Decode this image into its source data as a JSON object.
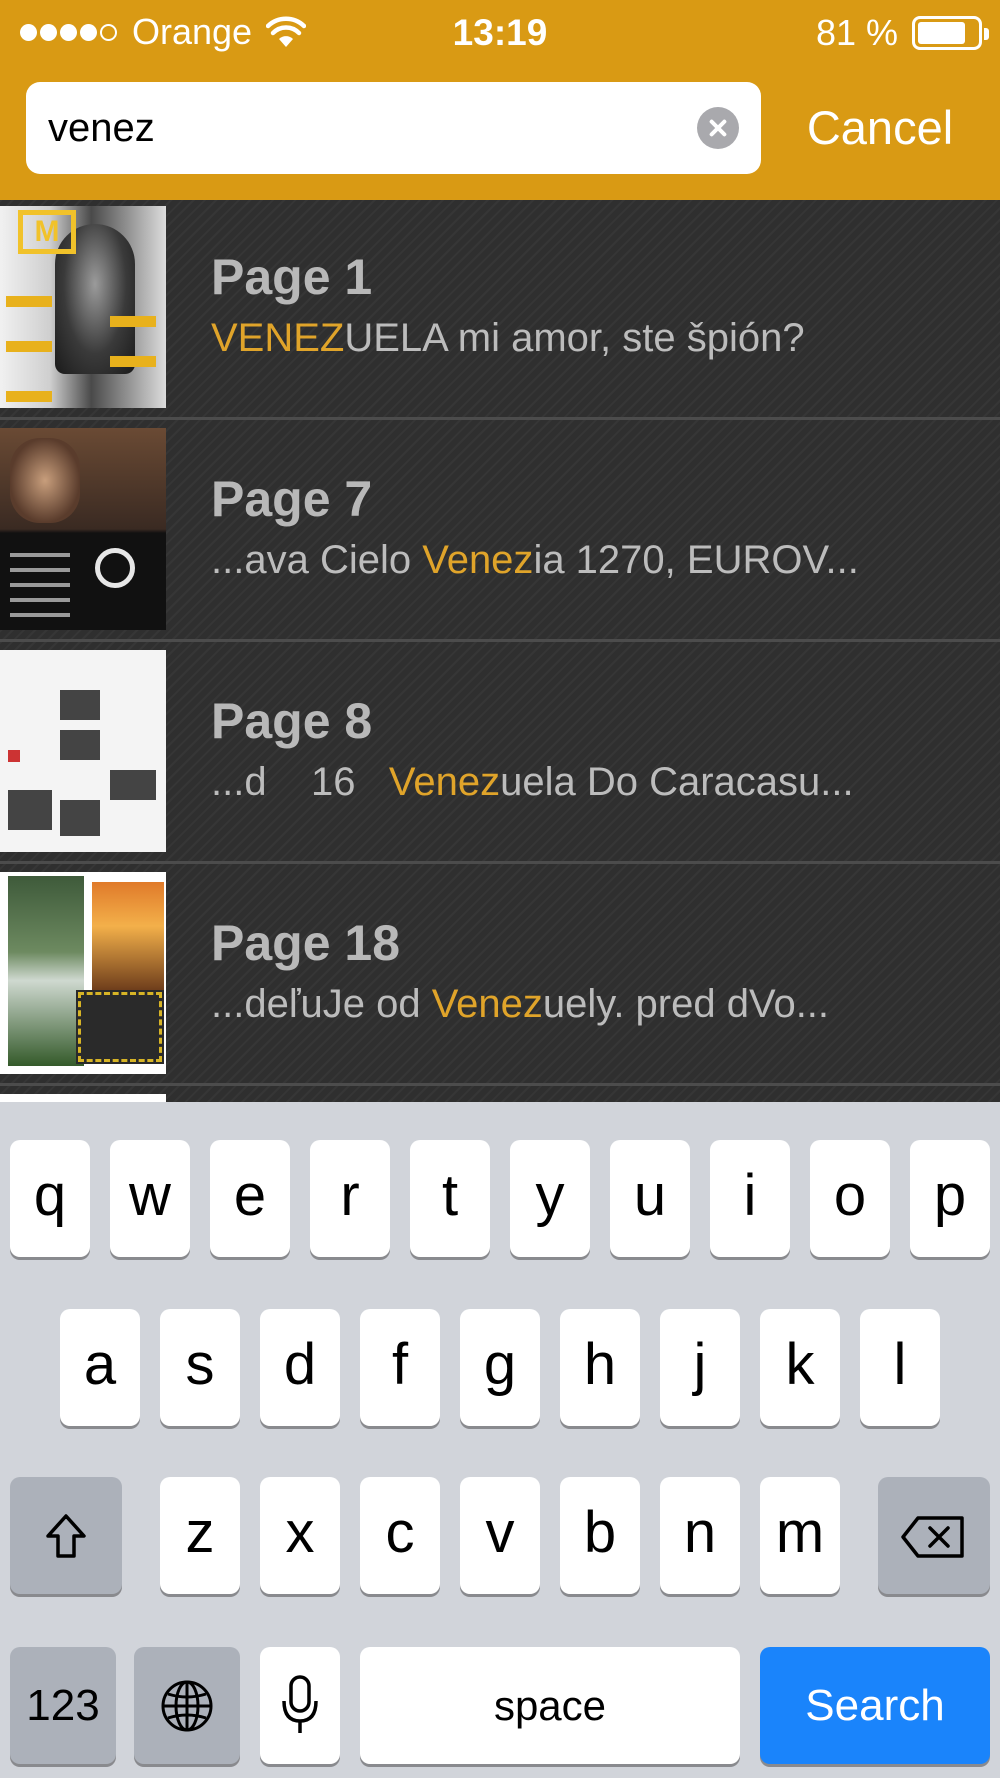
{
  "status_bar": {
    "carrier": "Orange",
    "time": "13:19",
    "battery_percent": "81 %",
    "battery_level": 0.81,
    "signal_bars": 4,
    "signal_total": 5
  },
  "search": {
    "value": "venez",
    "cancel_label": "Cancel"
  },
  "accent_color": "#d99a14",
  "highlight_color": "#e0a42a",
  "results": [
    {
      "page": "Page 1",
      "before": "",
      "match": "VENEZ",
      "after": "UELA mi amor, ste špión?"
    },
    {
      "page": "Page 7",
      "before": "...ava Cielo ",
      "match": "Venez",
      "after": "ia 1270, EUROV..."
    },
    {
      "page": "Page 8",
      "before": "...d    16   ",
      "match": "Venez",
      "after": "uela Do Caracasu..."
    },
    {
      "page": "Page 18",
      "before": "...deľuJe od ",
      "match": "Venez",
      "after": "uely. pred dVo..."
    }
  ],
  "keyboard": {
    "row1": [
      "q",
      "w",
      "e",
      "r",
      "t",
      "y",
      "u",
      "i",
      "o",
      "p"
    ],
    "row2": [
      "a",
      "s",
      "d",
      "f",
      "g",
      "h",
      "j",
      "k",
      "l"
    ],
    "row3": [
      "z",
      "x",
      "c",
      "v",
      "b",
      "n",
      "m"
    ],
    "numbers_label": "123",
    "space_label": "space",
    "search_label": "Search",
    "search_color": "#1a84fb"
  }
}
